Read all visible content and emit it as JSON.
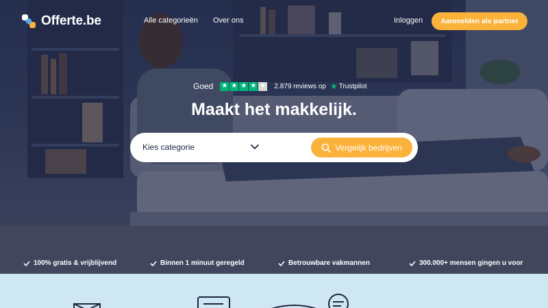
{
  "brand": {
    "name": "Offerte.be",
    "colors": {
      "accent": "#fbb23a",
      "navy": "#1e2540",
      "trustpilot": "#00b67a",
      "lower_band": "#cfe6f3"
    }
  },
  "nav": {
    "categories": "Alle categorieën",
    "about": "Over ons",
    "login": "Inloggen",
    "partner_button": "Aanmelden als partner"
  },
  "rating": {
    "word": "Goed",
    "stars": 4,
    "reviews": "2.879 reviews op",
    "provider": "Trustpilot"
  },
  "hero": {
    "headline": "Maakt het makkelijk."
  },
  "search": {
    "category_placeholder": "Kies categorie",
    "button": "Vergelijk bedrijven"
  },
  "usps": [
    "100% gratis & vrijblijvend",
    "Binnen 1 minuut geregeld",
    "Betrouwbare vakmannen",
    "300.000+ mensen gingen u voor"
  ],
  "icons": [
    "logo-mark-icon",
    "chevron-down-icon",
    "search-icon",
    "check-icon",
    "trustpilot-star-icon"
  ]
}
